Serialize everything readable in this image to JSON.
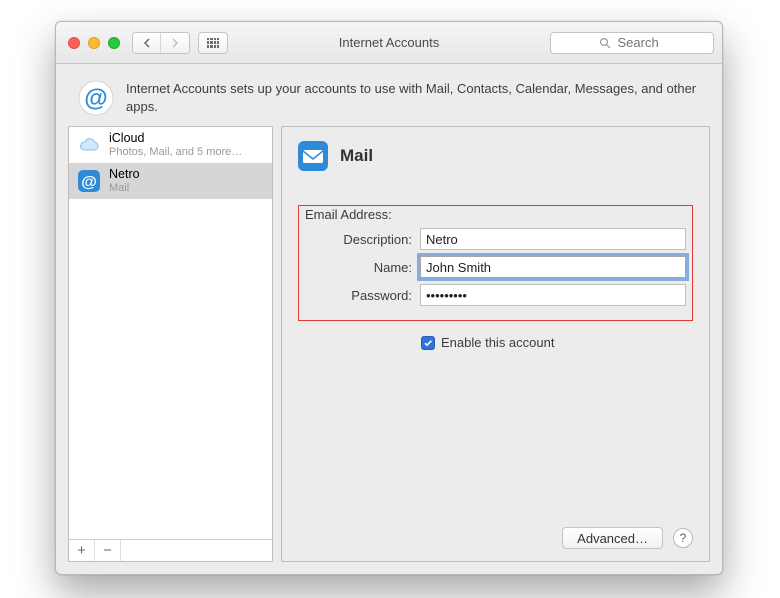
{
  "window": {
    "title": "Internet Accounts"
  },
  "search": {
    "placeholder": "Search"
  },
  "description": "Internet Accounts sets up your accounts to use with Mail, Contacts, Calendar, Messages, and other apps.",
  "sidebar": {
    "items": [
      {
        "name": "iCloud",
        "subtitle": "Photos, Mail, and 5 more…",
        "icon": "cloud",
        "selected": false
      },
      {
        "name": "Netro",
        "subtitle": "Mail",
        "icon": "at",
        "selected": true
      }
    ],
    "add_label": "+",
    "remove_label": "−"
  },
  "detail": {
    "app_name": "Mail",
    "section_label": "Email Address:",
    "fields": {
      "description": {
        "label": "Description:",
        "value": "Netro"
      },
      "name": {
        "label": "Name:",
        "value": "John Smith"
      },
      "password": {
        "label": "Password:",
        "value": "•••••••••"
      }
    },
    "enable_label": "Enable this account",
    "enable_checked": true,
    "advanced_label": "Advanced…",
    "help_label": "?"
  }
}
